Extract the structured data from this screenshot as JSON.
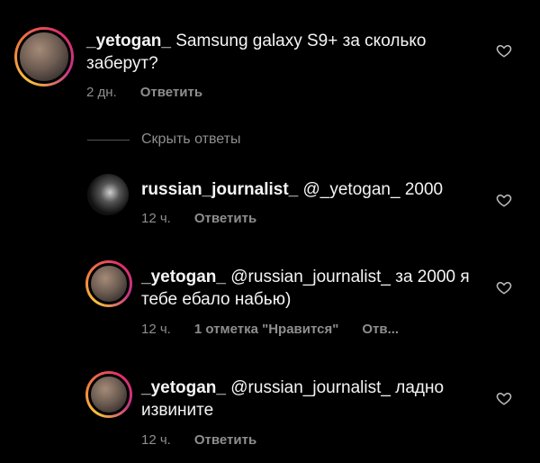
{
  "comments": [
    {
      "username": "_yetogan_",
      "text": " Samsung galaxy S9+ за сколько заберут?",
      "time": "2 дн.",
      "reply_label": "Ответить"
    },
    {
      "username": "russian_journalist_",
      "text": " @_yetogan_ 2000",
      "time": "12 ч.",
      "reply_label": "Ответить"
    },
    {
      "username": "_yetogan_",
      "text": " @russian_journalist_ за 2000 я тебе ебало набью)",
      "time": "12 ч.",
      "likes_label": "1 отметка \"Нравится\"",
      "reply_label": "Отв..."
    },
    {
      "username": "_yetogan_",
      "text": " @russian_journalist_ ладно извините",
      "time": "12 ч.",
      "reply_label": "Ответить"
    }
  ],
  "hide_replies_label": "Скрыть ответы",
  "icons": {
    "like": "heart-outline-icon"
  },
  "colors": {
    "background": "#000000",
    "text": "#f5f5f5",
    "meta": "#8e8e8e"
  }
}
